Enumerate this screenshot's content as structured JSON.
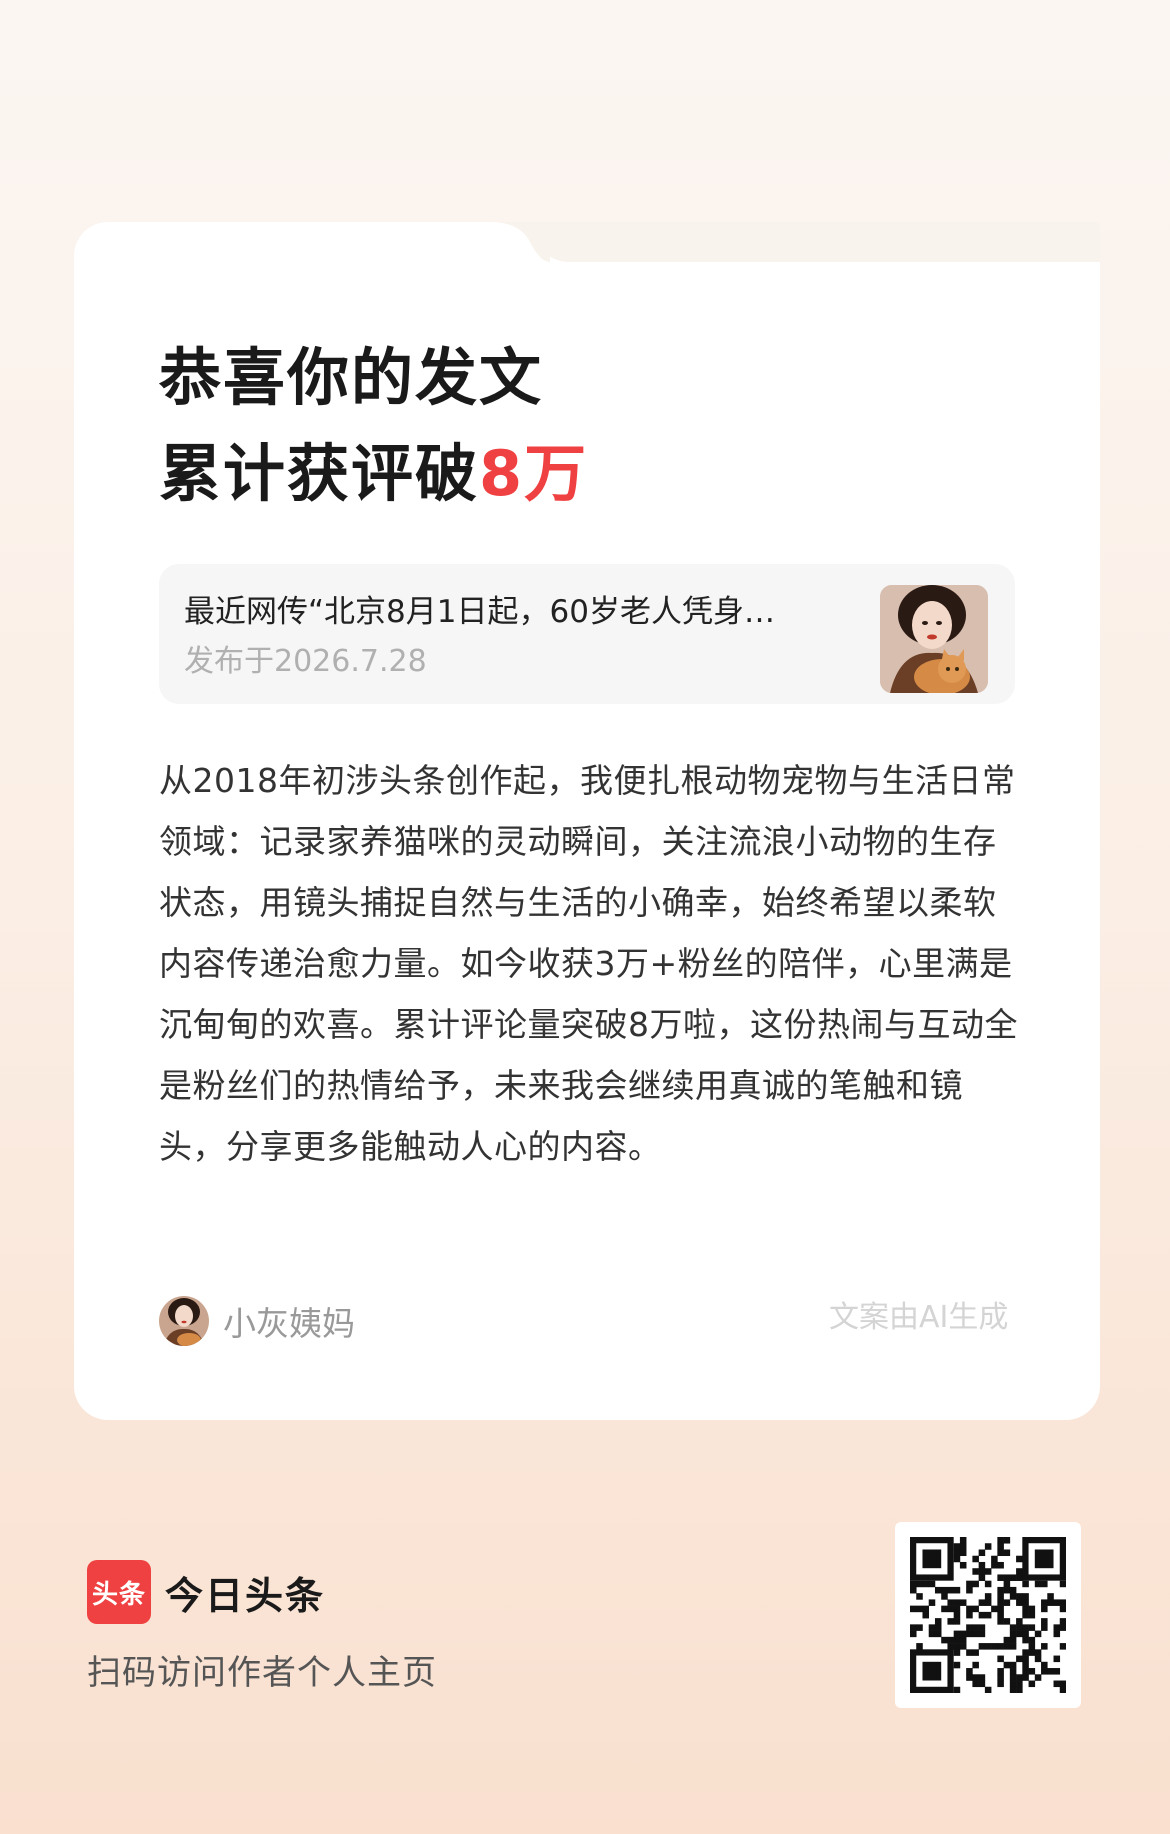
{
  "headline": {
    "line1": "恭喜你的发文",
    "line2_prefix": "累计获评破",
    "line2_highlight": "8万"
  },
  "post": {
    "title": "最近网传“北京8月1日起，60岁老人凭身…",
    "date": "发布于2026.7.28",
    "thumbnail_icon": "woman-with-cat-photo"
  },
  "body": {
    "text": "从2018年初涉头条创作起，我便扎根动物宠物与生活日常领域：记录家养猫咪的灵动瞬间，关注流浪小动物的生存状态，用镜头捕捉自然与生活的小确幸，始终希望以柔软内容传递治愈力量。如今收获3万+粉丝的陪伴，心里满是沉甸甸的欢喜。累计评论量突破8万啦，这份热闹与互动全是粉丝们的热情给予，未来我会继续用真诚的笔触和镜头，分享更多能触动人心的内容。"
  },
  "author": {
    "name": "小灰姨妈",
    "avatar_icon": "author-avatar-photo"
  },
  "ai_note": "文案由AI生成",
  "footer": {
    "logo_text": "头条",
    "brand_name": "今日头条",
    "scan_tip": "扫码访问作者个人主页",
    "qr_icon": "qr-code"
  },
  "colors": {
    "accent": "#f04142",
    "date_gray": "#b0b0b0",
    "body_text": "#333333"
  }
}
